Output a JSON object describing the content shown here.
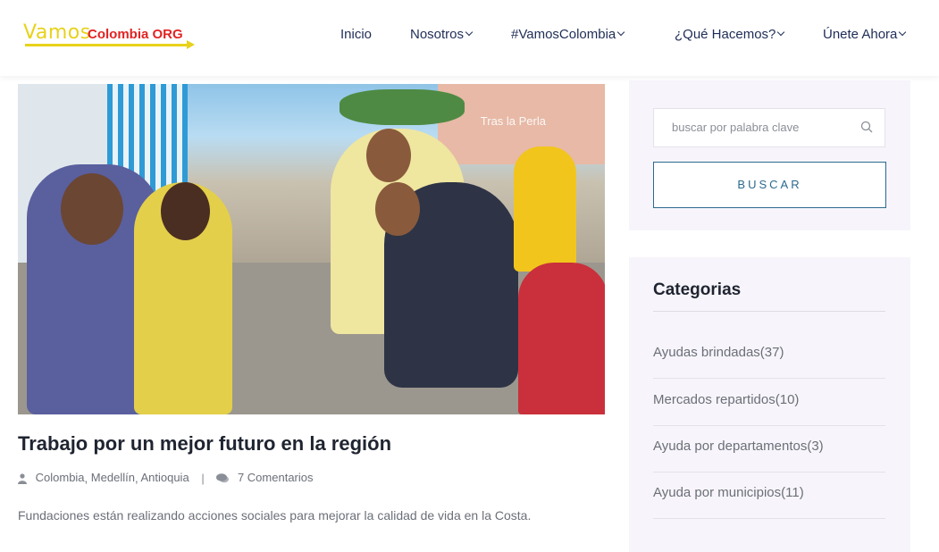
{
  "logo": {
    "word1": "Vamos",
    "word2": "Colombia ORG"
  },
  "nav": [
    {
      "label": "Inicio",
      "has_dropdown": false
    },
    {
      "label": "Nosotros",
      "has_dropdown": true
    },
    {
      "label": "#VamosColombia",
      "has_dropdown": true
    },
    {
      "label": "¿Qué Hacemos?",
      "has_dropdown": true
    },
    {
      "label": "Únete Ahora",
      "has_dropdown": true
    }
  ],
  "hero": {
    "watermark": "Tras la Perla"
  },
  "post": {
    "title": "Trabajo por un mejor futuro en la región",
    "tags": [
      "Colombia",
      "Medellín",
      "Antioquia"
    ],
    "tag_sep": ",",
    "meta_sep": "|",
    "comments": "7 Comentarios",
    "excerpt": "Fundaciones están realizando acciones sociales para mejorar la calidad de vida en la Costa."
  },
  "search": {
    "placeholder": "buscar por palabra clave",
    "button_label": "BUSCAR"
  },
  "categories": {
    "title": "Categorias",
    "items": [
      {
        "label": "Ayudas brindadas(37)"
      },
      {
        "label": "Mercados repartidos(10)"
      },
      {
        "label": "Ayuda por departamentos(3)"
      },
      {
        "label": "Ayuda por municipios(11)"
      }
    ]
  },
  "colors": {
    "nav_text": "#1f2d57",
    "accent": "#2b6a8e",
    "logo_yellow": "#e8d21b",
    "logo_red": "#e02424",
    "sidebar_bg": "#f7f5fb"
  }
}
